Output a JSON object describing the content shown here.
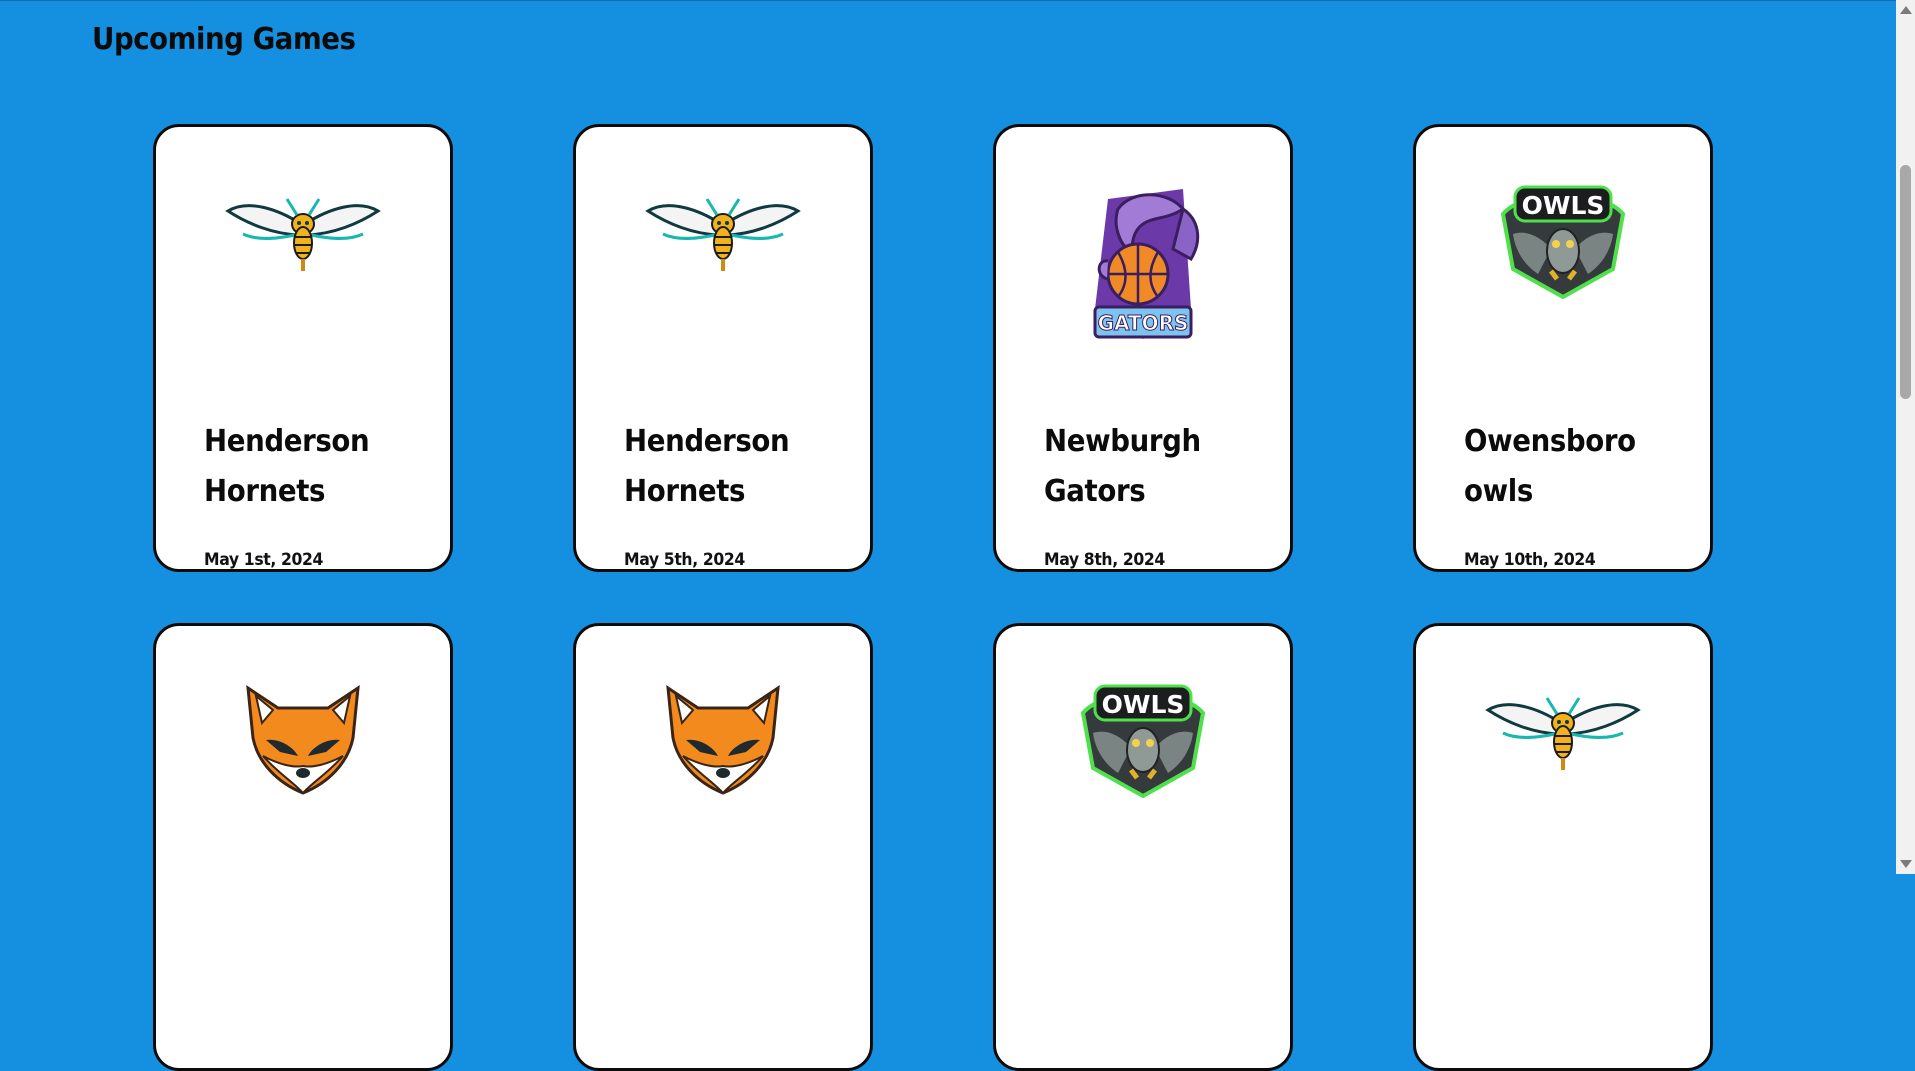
{
  "page": {
    "title": "Upcoming Games",
    "background": "#1590e0"
  },
  "games": [
    {
      "team": "Henderson Hornets",
      "date": "May 1st, 2024",
      "logo": "hornet-icon"
    },
    {
      "team": "Henderson Hornets",
      "date": "May 5th, 2024",
      "logo": "hornet-icon"
    },
    {
      "team": "Newburgh Gators",
      "date": "May 8th, 2024",
      "logo": "gator-icon"
    },
    {
      "team": "Owensboro owls",
      "date": "May 10th, 2024",
      "logo": "owl-icon"
    },
    {
      "team": "",
      "date": "",
      "logo": "fox-icon"
    },
    {
      "team": "",
      "date": "",
      "logo": "fox-icon"
    },
    {
      "team": "",
      "date": "",
      "logo": "owl-icon"
    },
    {
      "team": "",
      "date": "",
      "logo": "hornet-icon"
    }
  ],
  "owl_badge_text": "OWLS",
  "gator_badge_text": "GATORS"
}
